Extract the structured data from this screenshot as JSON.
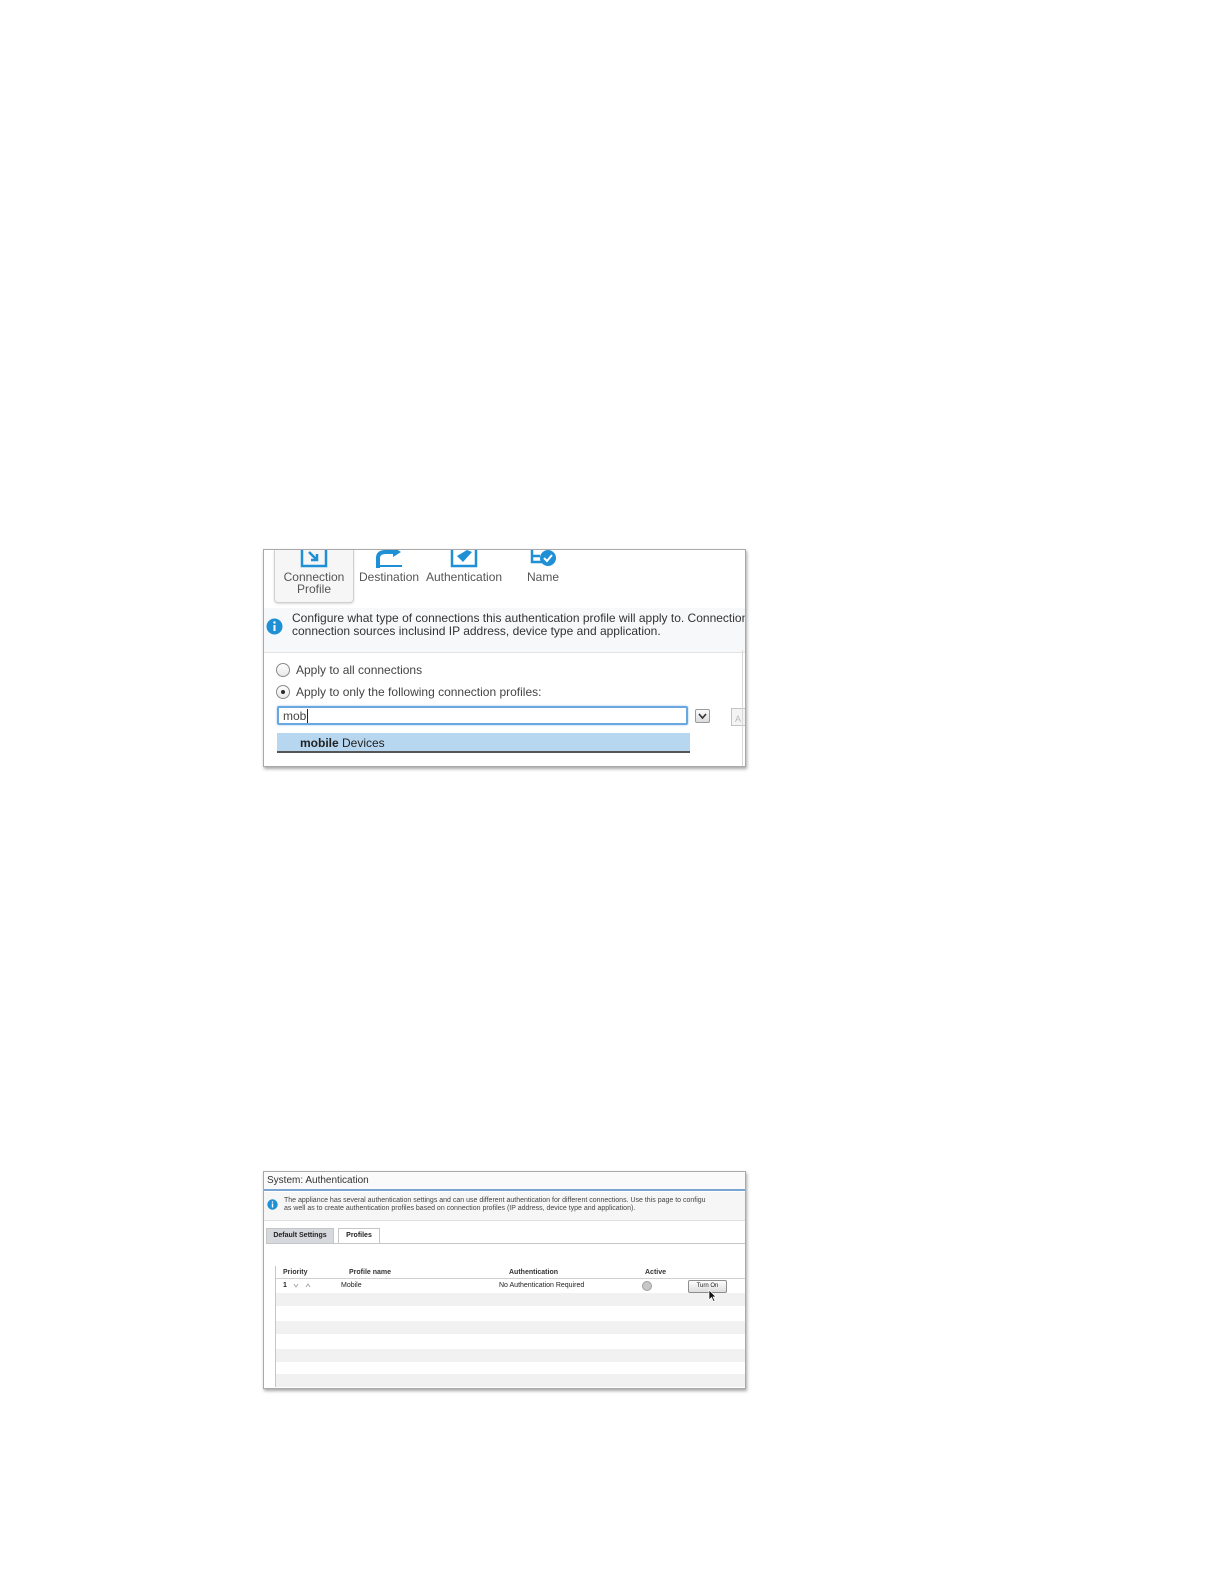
{
  "screenshot1": {
    "steps": [
      {
        "label_line1": "Connection",
        "label_line2": "Profile",
        "icon": "connection-profile-icon"
      },
      {
        "label": "Destination",
        "icon": "destination-icon"
      },
      {
        "label": "Authentication",
        "icon": "authentication-icon"
      },
      {
        "label": "Name",
        "icon": "name-check-icon"
      }
    ],
    "info_line1": "Configure what type of connections this authentication profile will apply to. Connection pr",
    "info_line2": "connection sources inclusind IP address, device type and application.",
    "radio_all": "Apply to all connections",
    "radio_following": "Apply to only the following connection profiles:",
    "search_value": "mob",
    "suggestion_match": "mobile",
    "suggestion_rest": " Devices",
    "add_button_label": "A"
  },
  "screenshot2": {
    "title": "System: Authentication",
    "info_line1": "The appliance has several authentication settings and can use different authentication for different connections. Use this page to configu",
    "info_line2": "as well as to create authentication profiles based on connection profiles (IP address, device type and application).",
    "tabs": [
      "Default Settings",
      "Profiles"
    ],
    "columns": [
      "Priority",
      "Profile name",
      "Authentication",
      "Active"
    ],
    "row": {
      "priority": "1",
      "profile_name": "Mobile",
      "authentication": "No Authentication Required",
      "action": "Turn On"
    }
  },
  "colors": {
    "accent": "#1f8fd6",
    "selection": "#b7d6ef",
    "focus": "#6aa7e0"
  }
}
